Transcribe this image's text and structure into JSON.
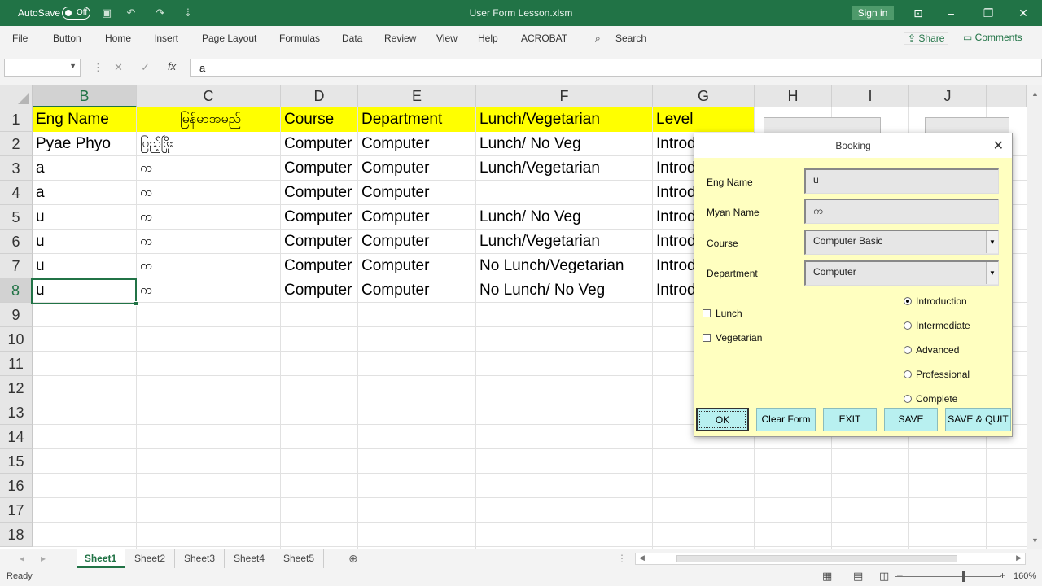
{
  "titlebar": {
    "autosave_label": "AutoSave",
    "autosave_state": "Off",
    "filename": "User Form Lesson.xlsm",
    "signin": "Sign in"
  },
  "menu": [
    "File",
    "Button",
    "Home",
    "Insert",
    "Page Layout",
    "Formulas",
    "Data",
    "Review",
    "View",
    "Help",
    "ACROBAT"
  ],
  "search_label": "Search",
  "share_label": "Share",
  "comments_label": "Comments",
  "formula": {
    "namebox": "",
    "fx": "fx",
    "value": "a"
  },
  "columns": [
    "B",
    "C",
    "D",
    "E",
    "F",
    "G",
    "H",
    "I",
    "J"
  ],
  "rows": [
    "1",
    "2",
    "3",
    "4",
    "5",
    "6",
    "7",
    "8",
    "9",
    "10",
    "11",
    "12",
    "13",
    "14",
    "15",
    "16",
    "17",
    "18"
  ],
  "table": {
    "header": [
      "Eng Name",
      "မြန်မာအမည်",
      "Course",
      "Department",
      "Lunch/Vegetarian",
      "Level"
    ],
    "rows": [
      [
        "Pyae Phyo",
        "ပြည့်ဖြိုး",
        "Computer",
        "Computer",
        "Lunch/ No Veg",
        "Introd"
      ],
      [
        "a",
        "က",
        "Computer",
        "Computer",
        "Lunch/Vegetarian",
        "Introd"
      ],
      [
        "a",
        "က",
        "Computer",
        "Computer",
        "",
        "Introd"
      ],
      [
        "u",
        "က",
        "Computer",
        "Computer",
        "Lunch/ No Veg",
        "Introd"
      ],
      [
        "u",
        "က",
        "Computer",
        "Computer",
        "Lunch/Vegetarian",
        "Introd"
      ],
      [
        "u",
        "က",
        "Computer",
        "Computer",
        "No Lunch/Vegetarian",
        "Introd"
      ],
      [
        "u",
        "က",
        "Computer",
        "Computer",
        "No Lunch/ No Veg",
        "Introd"
      ]
    ]
  },
  "sheets": [
    "Sheet1",
    "Sheet2",
    "Sheet3",
    "Sheet4",
    "Sheet5"
  ],
  "status": {
    "ready": "Ready",
    "zoom": "160%"
  },
  "dialog": {
    "title": "Booking",
    "eng_name_label": "Eng Name",
    "eng_name_value": "u",
    "myan_name_label": "Myan Name",
    "myan_name_value": "က",
    "course_label": "Course",
    "course_value": "Computer Basic",
    "department_label": "Department",
    "department_value": "Computer",
    "lunch_label": "Lunch",
    "lunch_checked": false,
    "veg_label": "Vegetarian",
    "veg_checked": false,
    "levels": [
      "Introduction",
      "Intermediate",
      "Advanced",
      "Professional",
      "Complete"
    ],
    "selected_level": "Introduction",
    "buttons": {
      "ok": "OK",
      "clear": "Clear Form",
      "exit": "EXIT",
      "save": "SAVE",
      "save_quit": "SAVE & QUIT"
    }
  }
}
